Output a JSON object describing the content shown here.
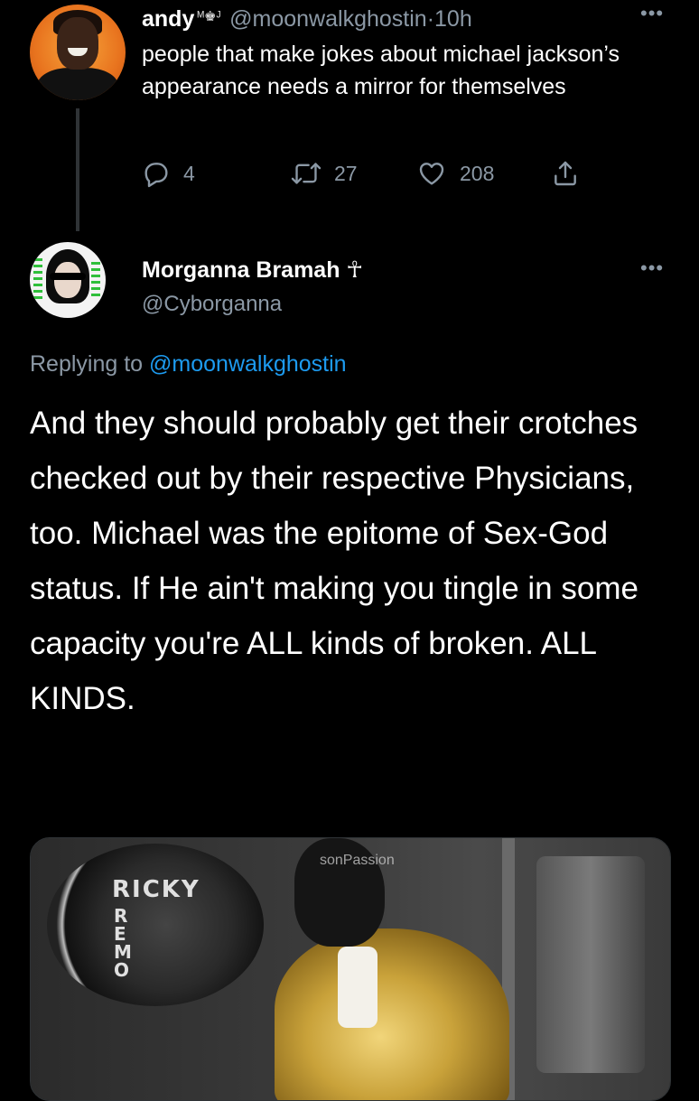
{
  "tweet1": {
    "name": "andy",
    "name_emoji": "ᴹ♚ᴶ",
    "handle": "@moonwalkghostin",
    "dot": "·",
    "time": "10h",
    "more": "•••",
    "text": "people that make jokes about michael jackson’s appearance needs a mirror for themselves",
    "actions": {
      "replies": "4",
      "retweets": "27",
      "likes": "208"
    },
    "icons": [
      "reply-icon",
      "retweet-icon",
      "like-icon",
      "share-icon"
    ]
  },
  "tweet2": {
    "name": "Morganna Bramah ☥",
    "handle": "@Cyborganna",
    "more": "•••",
    "replying_prefix": "Replying to ",
    "replying_handle": "@moonwalkghostin",
    "text": "And they should probably get their crotches checked out by their respective Physicians, too. Michael was the epitome of Sex-God status. If He ain't making you tingle in some capacity you're ALL kinds of broken. ALL KINDS.",
    "media": {
      "drum_text": "RICKY",
      "drum_vertical": "REMO",
      "watermark": "sonPassion"
    }
  },
  "colors": {
    "background": "#000000",
    "text": "#ffffff",
    "muted": "#8b98a5",
    "link": "#1d9bf0",
    "divider": "#2f3336"
  }
}
